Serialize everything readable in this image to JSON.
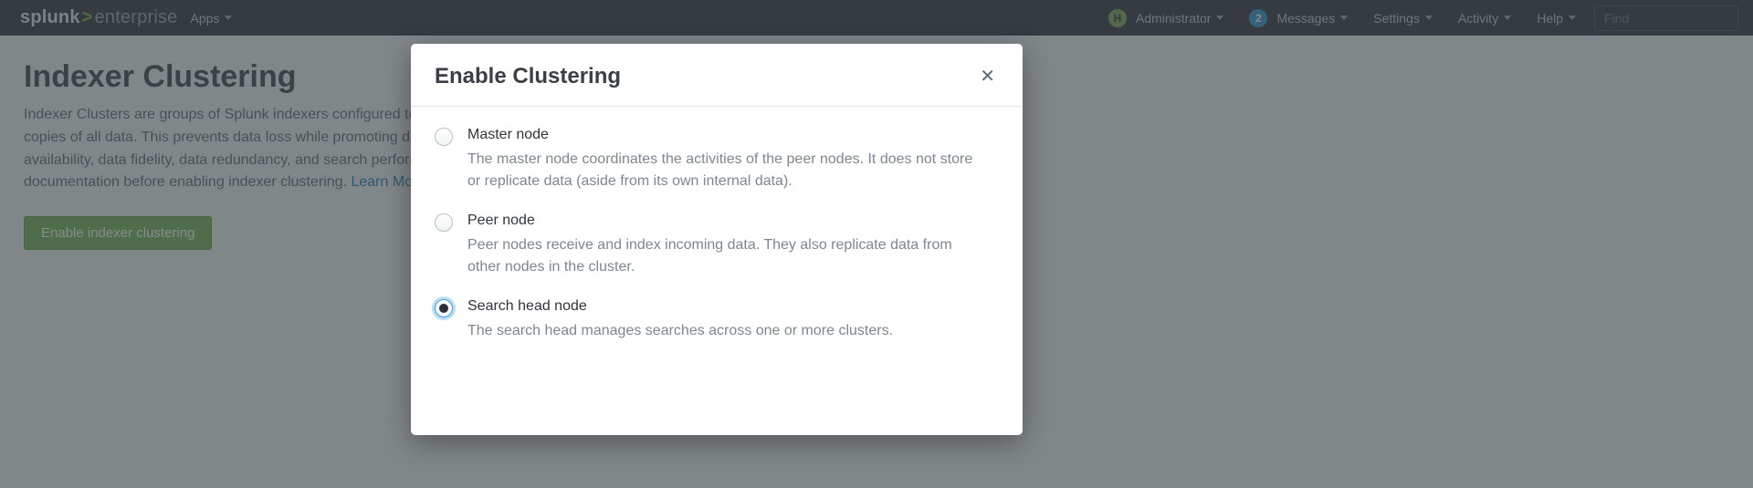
{
  "brand": {
    "prefix": "splunk",
    "gt": ">",
    "suffix": "enterprise"
  },
  "nav": {
    "apps": "Apps",
    "admin_badge": "H",
    "administrator": "Administrator",
    "messages_badge": "2",
    "messages": "Messages",
    "settings": "Settings",
    "activity": "Activity",
    "help": "Help",
    "search_placeholder": "Find"
  },
  "page": {
    "title": "Indexer Clustering",
    "subtitle_a": "Indexer Clusters are groups of Splunk indexers configured to replicate each others' data, so that the system keeps multiple copies of all data. This prevents data loss while promoting data",
    "subtitle_b": "availability, data fidelity, data redundancy, and search performance for searching. Review the",
    "subtitle_c": "documentation before enabling indexer clustering.",
    "learn_more": "Learn More",
    "enable_btn": "Enable indexer clustering"
  },
  "modal": {
    "title": "Enable Clustering",
    "options": [
      {
        "label": "Master node",
        "desc": "The master node coordinates the activities of the peer nodes. It does not store or replicate data (aside from its own internal data).",
        "selected": false
      },
      {
        "label": "Peer node",
        "desc": "Peer nodes receive and index incoming data. They also replicate data from other nodes in the cluster.",
        "selected": false
      },
      {
        "label": "Search head node",
        "desc": "The search head manages searches across one or more clusters.",
        "selected": true
      }
    ]
  }
}
